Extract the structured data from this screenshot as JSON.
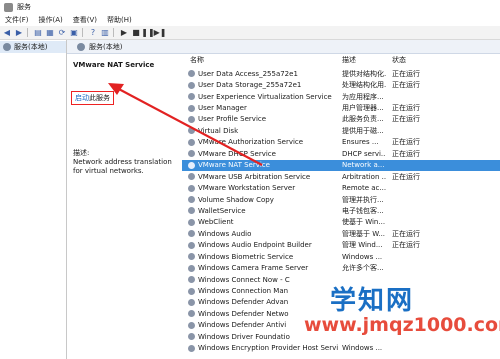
{
  "window": {
    "title": "服务"
  },
  "menu": [
    "文件(F)",
    "操作(A)",
    "查看(V)",
    "帮助(H)"
  ],
  "tree": {
    "selected_label": "服务(本地)"
  },
  "content_header": {
    "label": "服务(本地)"
  },
  "detail": {
    "service_title": "VMware NAT Service",
    "start_prefix": "启动",
    "start_suffix": "此服务",
    "desc_label": "描述:",
    "desc_text": "Network address translation for virtual networks."
  },
  "list": {
    "headers": {
      "name": "名称",
      "desc": "描述",
      "status": "状态"
    },
    "rows": [
      {
        "name": "User Data Access_255a72e1",
        "desc": "提供对结构化...",
        "status": "正在运行"
      },
      {
        "name": "User Data Storage_255a72e1",
        "desc": "处理结构化用...",
        "status": "正在运行"
      },
      {
        "name": "User Experience Virtualization Service",
        "desc": "为应用程序...",
        "status": ""
      },
      {
        "name": "User Manager",
        "desc": "用户管理器...",
        "status": "正在运行"
      },
      {
        "name": "User Profile Service",
        "desc": "此服务负责...",
        "status": "正在运行"
      },
      {
        "name": "Virtual Disk",
        "desc": "提供用于磁...",
        "status": ""
      },
      {
        "name": "VMware Authorization Service",
        "desc": "Ensures ...",
        "status": "正在运行"
      },
      {
        "name": "VMware DHCP Service",
        "desc": "DHCP servi...",
        "status": "正在运行"
      },
      {
        "name": "VMware NAT Service",
        "desc": "Network a...",
        "status": ""
      },
      {
        "name": "VMware USB Arbitration Service",
        "desc": "Arbitration ...",
        "status": "正在运行"
      },
      {
        "name": "VMware Workstation Server",
        "desc": "Remote ac...",
        "status": ""
      },
      {
        "name": "Volume Shadow Copy",
        "desc": "管理并执行...",
        "status": ""
      },
      {
        "name": "WalletService",
        "desc": "电子钱包客...",
        "status": ""
      },
      {
        "name": "WebClient",
        "desc": "使基于 Win...",
        "status": ""
      },
      {
        "name": "Windows Audio",
        "desc": "管理基于 W...",
        "status": "正在运行"
      },
      {
        "name": "Windows Audio Endpoint Builder",
        "desc": "管理 Wind...",
        "status": "正在运行"
      },
      {
        "name": "Windows Biometric Service",
        "desc": "Windows ...",
        "status": ""
      },
      {
        "name": "Windows Camera Frame Server",
        "desc": "允许多个客...",
        "status": ""
      },
      {
        "name": "Windows Connect Now - C",
        "desc": "",
        "status": ""
      },
      {
        "name": "Windows Connection Man",
        "desc": "",
        "status": ""
      },
      {
        "name": "Windows Defender Advan",
        "desc": "",
        "status": ""
      },
      {
        "name": "Windows Defender Netwo",
        "desc": "",
        "status": ""
      },
      {
        "name": "Windows Defender Antivi",
        "desc": "",
        "status": ""
      },
      {
        "name": "Windows Driver Foundatio",
        "desc": "",
        "status": ""
      },
      {
        "name": "Windows Encryption Provider Host Service",
        "desc": "Windows ...",
        "status": ""
      }
    ],
    "selected_index": 8
  },
  "watermark": {
    "text": "学知网",
    "url": "www.jmqz1000.com"
  },
  "colors": {
    "selection": "#3b8edb",
    "annotation": "#e22222",
    "link": "#1665c0"
  }
}
